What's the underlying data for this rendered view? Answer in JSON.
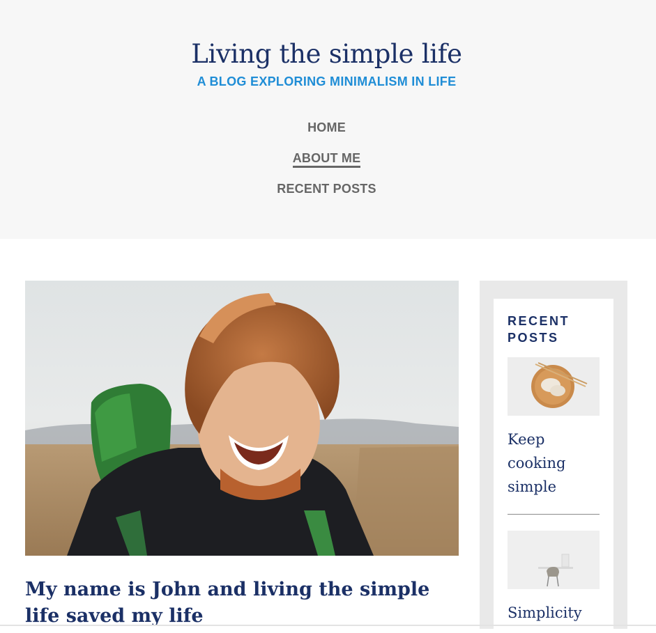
{
  "header": {
    "title": "Living the simple life",
    "tagline": "A BLOG EXPLORING MINIMALISM IN LIFE"
  },
  "nav": {
    "items": [
      {
        "label": "HOME",
        "active": false
      },
      {
        "label": "ABOUT ME",
        "active": true
      },
      {
        "label": "RECENT POSTS",
        "active": false
      }
    ]
  },
  "main": {
    "post_title": "My name is John and living the simple life saved my life"
  },
  "sidebar": {
    "widget_title": "RECENT POSTS",
    "posts": [
      {
        "title": "Keep cooking simple"
      },
      {
        "title": "Simplicity"
      }
    ]
  },
  "colors": {
    "title": "#1b3066",
    "tagline": "#1f8dd6",
    "nav": "#666666",
    "header_bg": "#f7f7f7",
    "sidebar_bg": "#e9e9e9"
  }
}
